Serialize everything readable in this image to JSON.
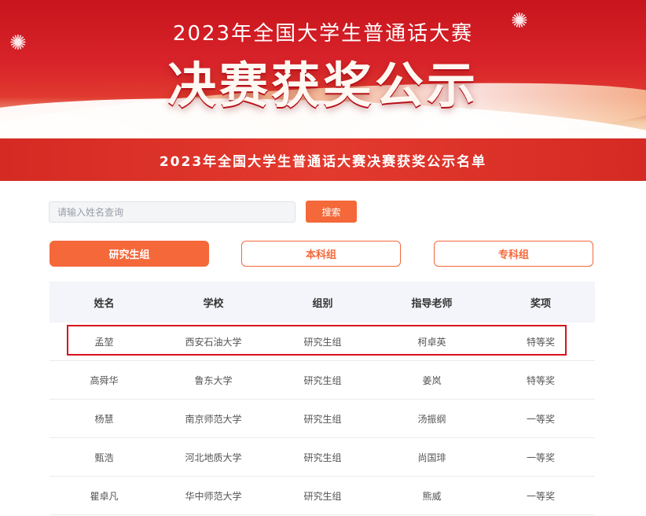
{
  "banner": {
    "subtitle": "2023年全国大学生普通话大赛",
    "title": "决赛获奖公示"
  },
  "strip_title": "2023年全国大学生普通话大赛决赛获奖公示名单",
  "search": {
    "placeholder": "请输入姓名查询",
    "button_label": "搜索"
  },
  "tabs": [
    {
      "label": "研究生组",
      "active": true
    },
    {
      "label": "本科组",
      "active": false
    },
    {
      "label": "专科组",
      "active": false
    }
  ],
  "table": {
    "headers": [
      "姓名",
      "学校",
      "组别",
      "指导老师",
      "奖项"
    ],
    "rows": [
      [
        "孟堃",
        "西安石油大学",
        "研究生组",
        "柯卓英",
        "特等奖"
      ],
      [
        "高舜华",
        "鲁东大学",
        "研究生组",
        "姜岚",
        "特等奖"
      ],
      [
        "杨慧",
        "南京师范大学",
        "研究生组",
        "汤振纲",
        "一等奖"
      ],
      [
        "甄浩",
        "河北地质大学",
        "研究生组",
        "尚国琲",
        "一等奖"
      ],
      [
        "瞿卓凡",
        "华中师范大学",
        "研究生组",
        "熊威",
        "一等奖"
      ]
    ]
  },
  "colors": {
    "accent": "#f4683a",
    "banner_red": "#d8232a",
    "highlight_border": "#d8121e"
  }
}
